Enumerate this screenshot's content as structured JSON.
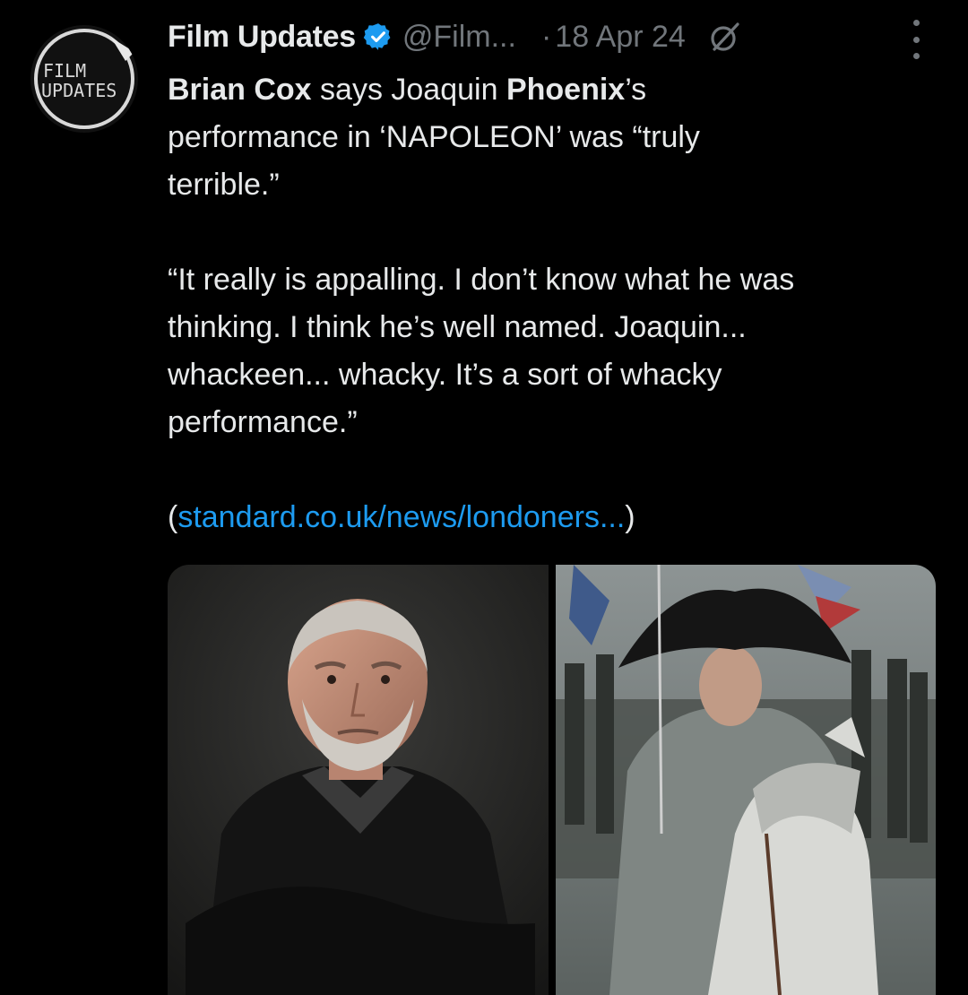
{
  "author": {
    "display_name": "Film Updates",
    "handle": "@Film...",
    "separator": "·",
    "date": "18 Apr 24",
    "avatar_text_line1": "FILM",
    "avatar_text_line2": "UPDATES",
    "avatar_icon": "film-updates-logo",
    "verified_icon": "verified-badge-icon"
  },
  "tweet": {
    "line1_bold1": "Brian Cox",
    "line1_mid": " says Joaquin ",
    "line1_bold2": "Phoenix",
    "line1_end": "’s",
    "line2": "performance in ‘NAPOLEON’ was “truly",
    "line3": "terrible.”",
    "quote_line1": "“It really is appalling. I don’t know what he was",
    "quote_line2": "thinking. I think he’s well named. Joaquin...",
    "quote_line3": "whackeen... whacky. It’s a sort of whacky",
    "quote_line4": "performance.”",
    "link_open": "(",
    "link_text": "standard.co.uk/news/londoners...",
    "link_close": ")"
  },
  "media": [
    {
      "alt_name": "brian-cox-portrait"
    },
    {
      "alt_name": "napoleon-film-still"
    }
  ],
  "colors": {
    "background": "#000000",
    "text": "#e7e9ea",
    "secondary": "#71767b",
    "link": "#1d9bf0",
    "verified": "#1d9bf0"
  }
}
